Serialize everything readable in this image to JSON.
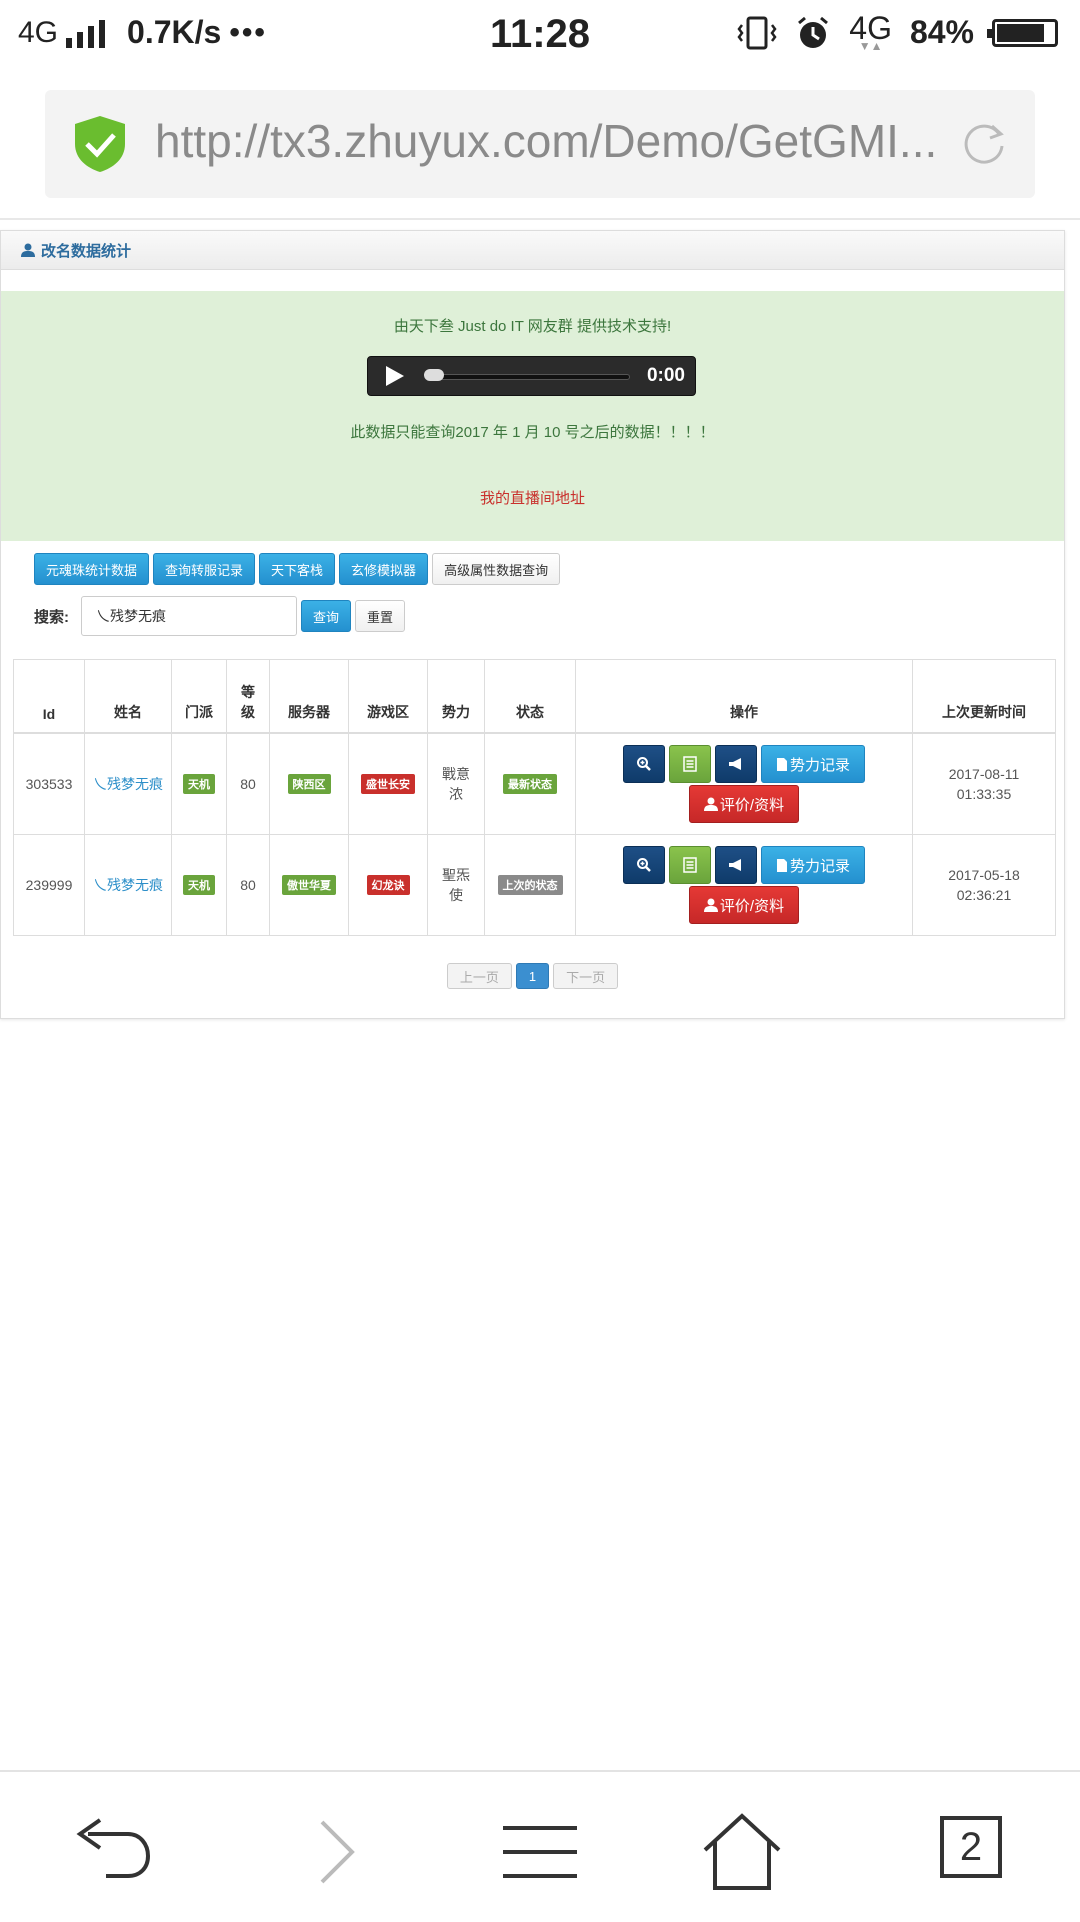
{
  "status_bar": {
    "network": "4G",
    "speed": "0.7K/s",
    "dots": "•••",
    "time": "11:28",
    "data_network": "4G",
    "battery": "84%",
    "battery_level": 0.84,
    "icons": [
      "vibrate-icon",
      "alarm-icon",
      "data-arrows-icon",
      "battery-icon"
    ]
  },
  "browser": {
    "url": "http://tx3.zhuyux.com/Demo/GetGMI...",
    "security_icon": "shield-check-icon",
    "reload_icon": "reload-icon",
    "colors": {
      "shield": "#6abd2f"
    }
  },
  "panel": {
    "title": "改名数据统计",
    "title_icon": "user-icon",
    "notice": {
      "support_text": "由天下叁 Just do IT 网友群 提供技术支持!",
      "audio_time": "0:00",
      "data_notice": "此数据只能查询2017 年 1 月 10 号之后的数据！！！！",
      "live_link": "我的直播间地址"
    },
    "toolbar": {
      "buttons": [
        "元魂珠统计数据",
        "查询转服记录",
        "天下客栈",
        "玄修模拟器",
        "高级属性数据查询"
      ]
    },
    "search": {
      "label": "搜索:",
      "value": "乀残梦无痕",
      "query_button": "查询",
      "reset_button": "重置"
    },
    "table": {
      "headers": [
        "Id",
        "姓名",
        "门派",
        "等级",
        "服务器",
        "游戏区",
        "势力",
        "状态",
        "操作",
        "上次更新时间"
      ],
      "rows": [
        {
          "id": "303533",
          "name": "乀残梦无痕",
          "sect": "天机",
          "level": "80",
          "server": "陕西区",
          "zone": "盛世长安",
          "faction": "戰意浓",
          "status": "最新状态",
          "updated_date": "2017-08-11",
          "updated_time": "01:33:35"
        },
        {
          "id": "239999",
          "name": "乀残梦无痕",
          "sect": "天机",
          "level": "80",
          "server": "傲世华夏",
          "zone": "幻龙诀",
          "faction": "聖炁使",
          "status": "上次的状态",
          "updated_date": "2017-05-18",
          "updated_time": "02:36:21"
        }
      ],
      "ops": {
        "faction_record": "势力记录",
        "review": "评价/资料"
      }
    },
    "pager": {
      "prev": "上一页",
      "current": "1",
      "next": "下一页"
    }
  },
  "bottom_nav": {
    "tab_count": "2",
    "icons": [
      "back-icon",
      "forward-icon",
      "menu-icon",
      "home-icon",
      "tabs-icon"
    ]
  },
  "colors": {
    "primary_blue": "#2490cf",
    "notice_bg": "#dff0d8",
    "notice_text": "#3c763d",
    "danger": "#c9302c",
    "label_green": "#6aa43c",
    "navy": "#0f3b6a"
  }
}
